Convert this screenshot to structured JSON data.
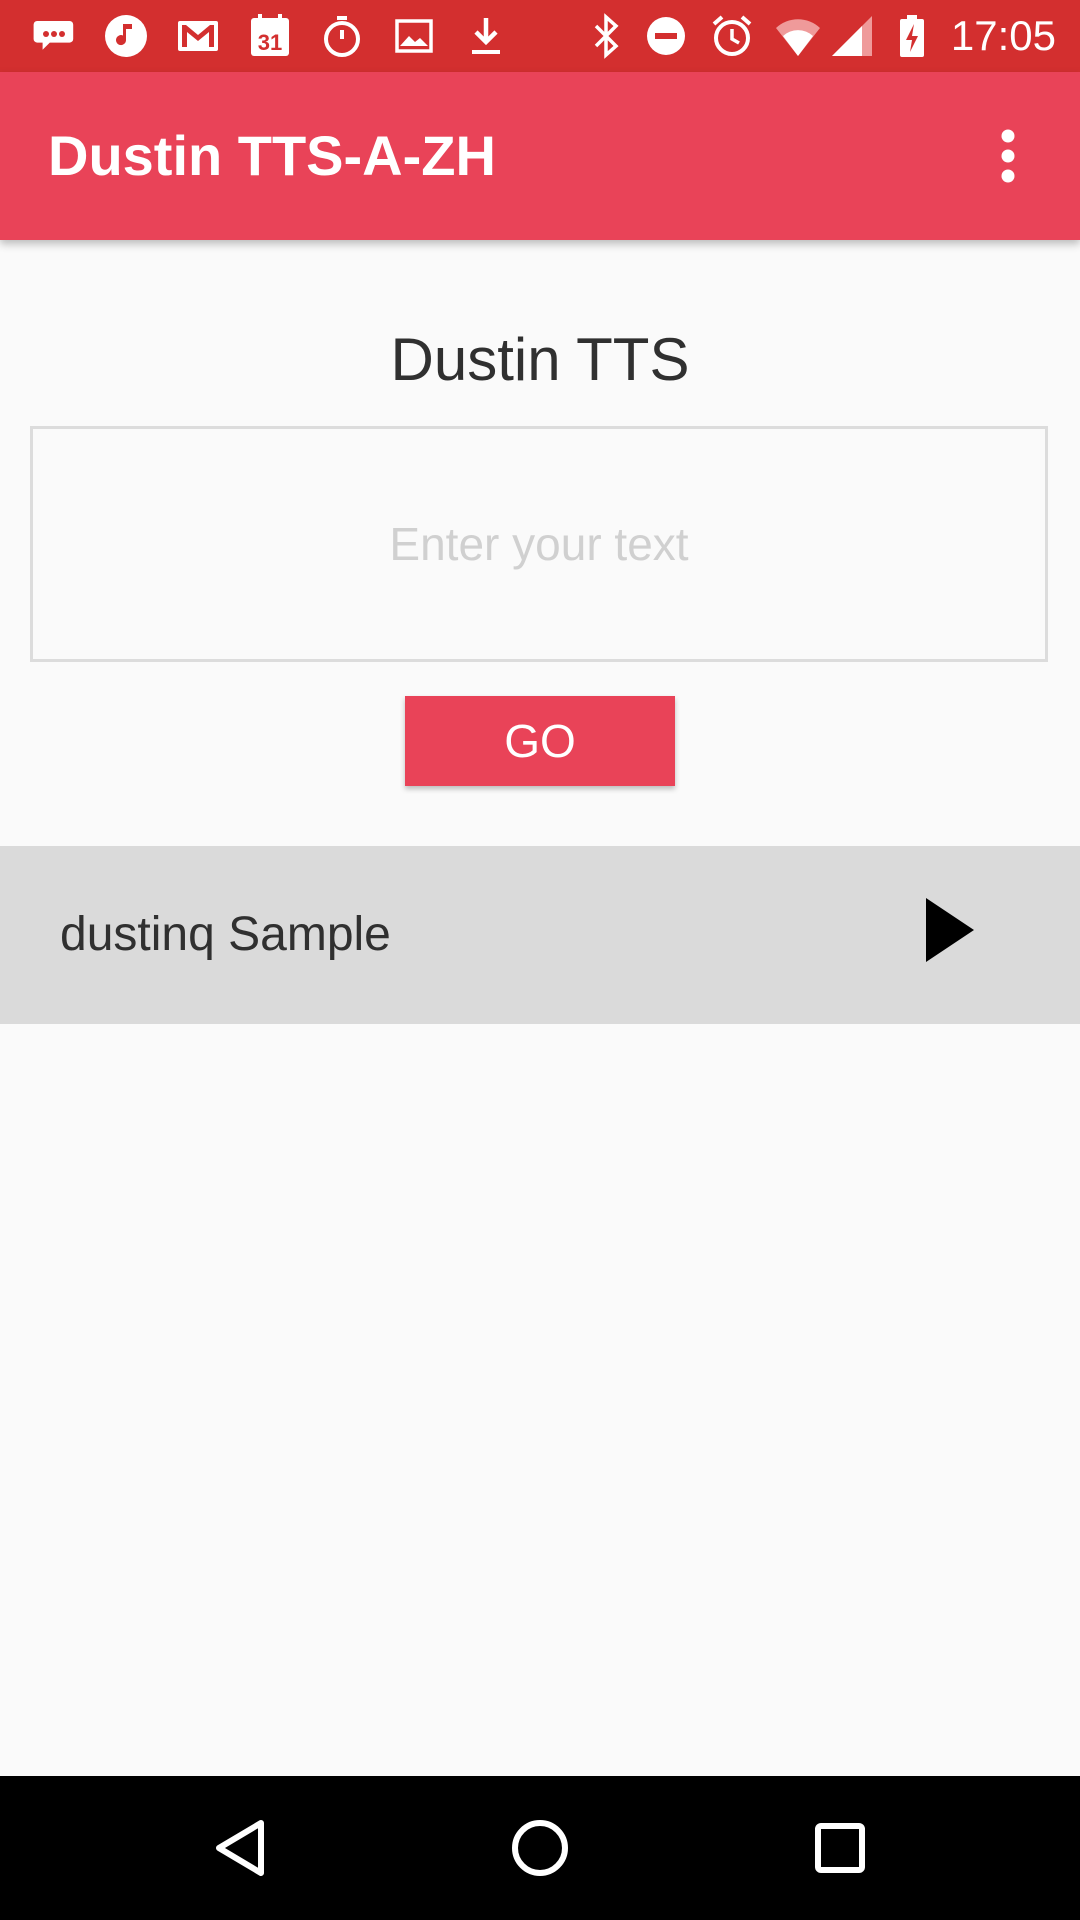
{
  "status_bar": {
    "time": "17:05",
    "left_icons": [
      "chat-bubble-icon",
      "music-note-icon",
      "gmail-icon",
      "calendar-icon",
      "stopwatch-icon",
      "image-icon",
      "download-icon"
    ],
    "right_icons": [
      "bluetooth-icon",
      "do-not-disturb-icon",
      "alarm-icon",
      "wifi-icon",
      "cell-signal-icon",
      "battery-charging-icon"
    ],
    "calendar_day": "31",
    "color": "#d32f2f"
  },
  "app_bar": {
    "title": "Dustin TTS-A-ZH",
    "menu_icon": "more-vert-icon",
    "color": "#e94358"
  },
  "main": {
    "heading": "Dustin TTS",
    "input": {
      "placeholder": "Enter your text",
      "value": ""
    },
    "go_button_label": "GO",
    "sample_row": {
      "label": "dustinq Sample",
      "icon": "play-icon"
    }
  },
  "nav_bar": {
    "buttons": [
      "back-icon",
      "home-icon",
      "recents-icon"
    ]
  }
}
